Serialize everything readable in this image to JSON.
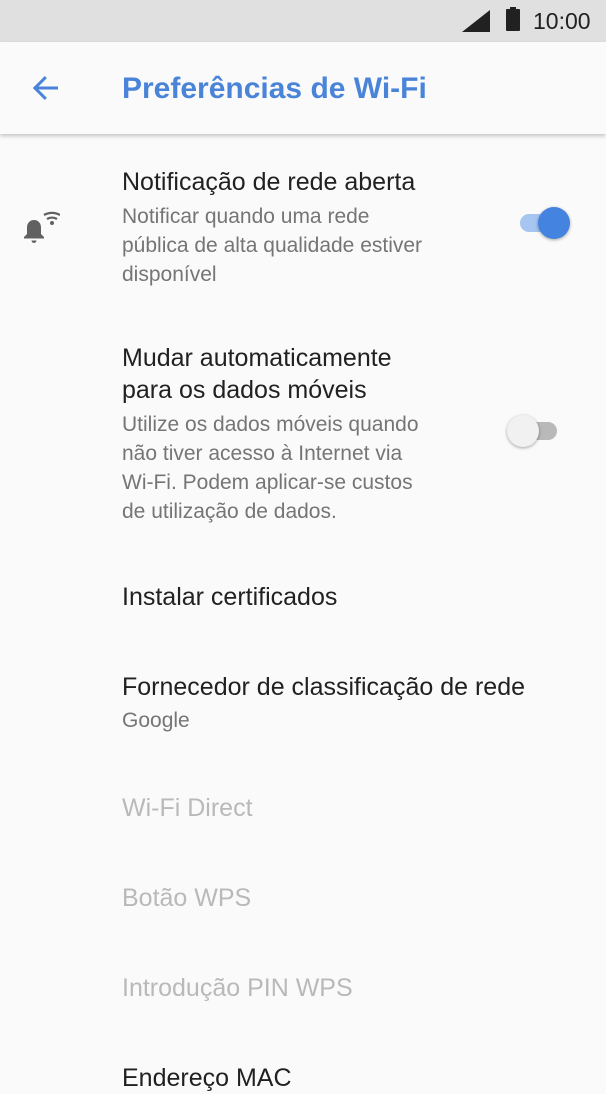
{
  "status_bar": {
    "time": "10:00",
    "icons": [
      "signal-icon",
      "battery-icon"
    ]
  },
  "app_bar": {
    "back_icon": "arrow-left-icon",
    "title": "Preferências de Wi-Fi"
  },
  "colors": {
    "accent": "#4a84d8",
    "switch_on_thumb": "#4483e0",
    "switch_on_track": "#a6c5f1"
  },
  "preferences": {
    "open_network": {
      "icon": "wifi-bell-icon",
      "title": "Notificação de rede aberta",
      "summary": [
        "Notificar quando uma rede",
        "pública de alta qualidade estiver",
        "disponível"
      ],
      "enabled": true
    },
    "auto_switch": {
      "title": [
        "Mudar automaticamente",
        "para os dados móveis"
      ],
      "summary": [
        "Utilize os dados móveis quando",
        "não tiver acesso à Internet via",
        "Wi-Fi. Podem aplicar-se custos",
        "de utilização de dados."
      ],
      "enabled": false
    },
    "install_certificates": {
      "title": "Instalar certificados"
    },
    "network_rating": {
      "title": "Fornecedor de classificação de rede",
      "summary": "Google"
    },
    "wifi_direct": {
      "title": "Wi-Fi Direct"
    },
    "wps_button": {
      "title": "Botão WPS"
    },
    "wps_pin": {
      "title": "Introdução PIN WPS"
    },
    "mac_address": {
      "title": "Endereço MAC"
    }
  }
}
